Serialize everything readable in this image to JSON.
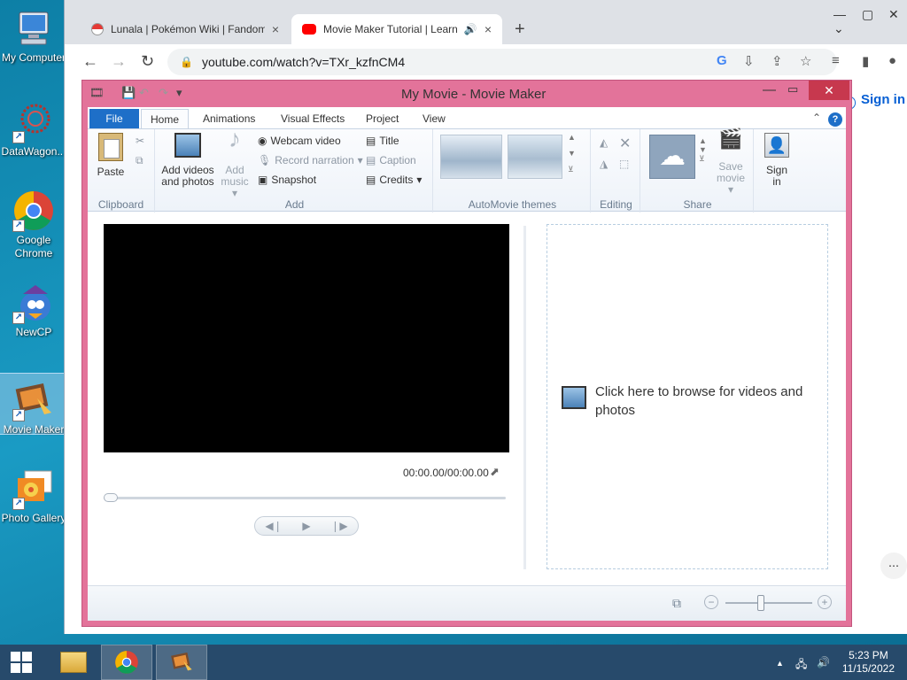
{
  "desktop": {
    "icons": [
      {
        "label": "My Computer",
        "icon": "computer-icon"
      },
      {
        "label": "DataWagon...",
        "icon": "datawagon-icon"
      },
      {
        "label": "Google Chrome",
        "icon": "chrome-icon"
      },
      {
        "label": "NewCP",
        "icon": "newcp-icon"
      },
      {
        "label": "Movie Maker",
        "icon": "movie-maker-icon"
      },
      {
        "label": "Photo Gallery",
        "icon": "photo-gallery-icon"
      }
    ]
  },
  "browser": {
    "tabs": [
      {
        "title": "Lunala | Pokémon Wiki | Fandom",
        "close": "×"
      },
      {
        "title": "Movie Maker Tutorial | Learn",
        "close": "×"
      }
    ],
    "new_tab": "+",
    "url": "youtube.com/watch?v=TXr_kzfnCM4",
    "page_sign_in": "Sign in"
  },
  "moviemaker": {
    "title": "My Movie - Movie Maker",
    "menu_tabs": [
      "File",
      "Home",
      "Animations",
      "Visual Effects",
      "Project",
      "View"
    ],
    "ribbon": {
      "clipboard": {
        "paste": "Paste",
        "label": "Clipboard"
      },
      "add": {
        "add_videos_line1": "Add videos",
        "add_videos_line2": "and photos",
        "add_music_line1": "Add",
        "add_music_line2": "music",
        "webcam": "Webcam video",
        "record": "Record narration",
        "snapshot": "Snapshot",
        "title": "Title",
        "caption": "Caption",
        "credits": "Credits",
        "label": "Add"
      },
      "themes": {
        "label": "AutoMovie themes"
      },
      "editing": {
        "label": "Editing"
      },
      "share": {
        "save_line1": "Save",
        "save_line2": "movie",
        "label": "Share"
      },
      "signin": {
        "line1": "Sign",
        "line2": "in"
      }
    },
    "preview": {
      "time": "00:00.00/00:00.00"
    },
    "storyboard": {
      "browse_text": "Click here to browse for videos and photos"
    }
  },
  "taskbar": {
    "time": "5:23 PM",
    "date": "11/15/2022"
  }
}
